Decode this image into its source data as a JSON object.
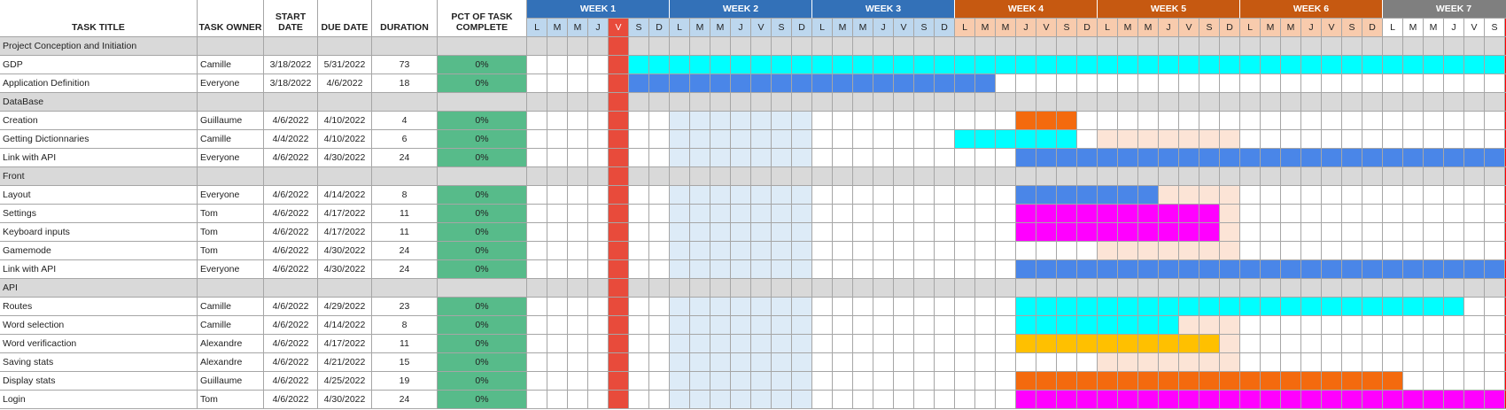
{
  "headers": {
    "task_title": "TASK TITLE",
    "task_owner": "TASK OWNER",
    "start_date": "START DATE",
    "due_date": "DUE DATE",
    "duration": "DURATION",
    "pct_complete": "PCT OF TASK COMPLETE"
  },
  "weeks": [
    {
      "label": "WEEK 1",
      "color": "#3371b8"
    },
    {
      "label": "WEEK 2",
      "color": "#3371b8"
    },
    {
      "label": "WEEK 3",
      "color": "#3371b8"
    },
    {
      "label": "WEEK 4",
      "color": "#c65911"
    },
    {
      "label": "WEEK 5",
      "color": "#c65911"
    },
    {
      "label": "WEEK 6",
      "color": "#c65911"
    },
    {
      "label": "WEEK 7",
      "color": "#7f7f7f"
    }
  ],
  "day_letters": [
    "L",
    "M",
    "M",
    "J",
    "V",
    "S",
    "D"
  ],
  "colors": {
    "red_day": "#e84b3b",
    "red_last": "#ff0000",
    "light_blue_shade": "#ddebf7",
    "light_blue_header": "#bdd7ee",
    "peach_shade": "#fce4d6",
    "peach_header": "#f8cbad",
    "cyan": "#00ffff",
    "blue": "#4a86e8",
    "orange": "#f46a0e",
    "magenta": "#ff00ff",
    "yellow": "#ffc000",
    "pct_green": "#57bb8a"
  },
  "rows": [
    {
      "type": "group",
      "title": "Project Conception and Initiation"
    },
    {
      "type": "task",
      "title": "GDP",
      "owner": "Camille",
      "start": "3/18/2022",
      "due": "5/31/2022",
      "duration": "73",
      "pct": "0%",
      "bar_start": 5,
      "bar_end": 48,
      "bar_color": "#00ffff"
    },
    {
      "type": "task",
      "title": "Application Definition",
      "owner": "Everyone",
      "start": "3/18/2022",
      "due": "4/6/2022",
      "duration": "18",
      "pct": "0%",
      "bar_start": 5,
      "bar_end": 23,
      "bar_color": "#4a86e8"
    },
    {
      "type": "group",
      "title": "DataBase"
    },
    {
      "type": "task",
      "title": "Creation",
      "owner": "Guillaume",
      "start": "4/6/2022",
      "due": "4/10/2022",
      "duration": "4",
      "pct": "0%",
      "bar_start": 24,
      "bar_end": 27,
      "bar_color": "#f46a0e"
    },
    {
      "type": "task",
      "title": "Getting Dictionnaries",
      "owner": "Camille",
      "start": "4/4/2022",
      "due": "4/10/2022",
      "duration": "6",
      "pct": "0%",
      "bar_start": 21,
      "bar_end": 27,
      "bar_color": "#00ffff"
    },
    {
      "type": "task",
      "title": "Link with API",
      "owner": "Everyone",
      "start": "4/6/2022",
      "due": "4/30/2022",
      "duration": "24",
      "pct": "0%",
      "bar_start": 24,
      "bar_end": 48,
      "bar_color": "#4a86e8"
    },
    {
      "type": "group",
      "title": "Front"
    },
    {
      "type": "task",
      "title": "Layout",
      "owner": "Everyone",
      "start": "4/6/2022",
      "due": "4/14/2022",
      "duration": "8",
      "pct": "0%",
      "bar_start": 24,
      "bar_end": 31,
      "bar_color": "#4a86e8"
    },
    {
      "type": "task",
      "title": "Settings",
      "owner": "Tom",
      "start": "4/6/2022",
      "due": "4/17/2022",
      "duration": "11",
      "pct": "0%",
      "bar_start": 24,
      "bar_end": 34,
      "bar_color": "#ff00ff"
    },
    {
      "type": "task",
      "title": "Keyboard inputs",
      "owner": "Tom",
      "start": "4/6/2022",
      "due": "4/17/2022",
      "duration": "11",
      "pct": "0%",
      "bar_start": 24,
      "bar_end": 34,
      "bar_color": "#ff00ff"
    },
    {
      "type": "task",
      "title": "Gamemode",
      "owner": "Tom",
      "start": "4/6/2022",
      "due": "4/30/2022",
      "duration": "24",
      "pct": "0%",
      "bar_start": -1,
      "bar_end": -1,
      "bar_color": ""
    },
    {
      "type": "task",
      "title": "Link with API",
      "owner": "Everyone",
      "start": "4/6/2022",
      "due": "4/30/2022",
      "duration": "24",
      "pct": "0%",
      "bar_start": 24,
      "bar_end": 48,
      "bar_color": "#4a86e8"
    },
    {
      "type": "group",
      "title": "API"
    },
    {
      "type": "task",
      "title": "Routes",
      "owner": "Camille",
      "start": "4/6/2022",
      "due": "4/29/2022",
      "duration": "23",
      "pct": "0%",
      "bar_start": 24,
      "bar_end": 46,
      "bar_color": "#00ffff"
    },
    {
      "type": "task",
      "title": "Word selection",
      "owner": "Camille",
      "start": "4/6/2022",
      "due": "4/14/2022",
      "duration": "8",
      "pct": "0%",
      "bar_start": 24,
      "bar_end": 32,
      "bar_color": "#00ffff"
    },
    {
      "type": "task",
      "title": "Word verificaction",
      "owner": "Alexandre",
      "start": "4/6/2022",
      "due": "4/17/2022",
      "duration": "11",
      "pct": "0%",
      "bar_start": 24,
      "bar_end": 34,
      "bar_color": "#ffc000"
    },
    {
      "type": "task",
      "title": "Saving stats",
      "owner": "Alexandre",
      "start": "4/6/2022",
      "due": "4/21/2022",
      "duration": "15",
      "pct": "0%",
      "bar_start": -1,
      "bar_end": -1,
      "bar_color": ""
    },
    {
      "type": "task",
      "title": "Display stats",
      "owner": "Guillaume",
      "start": "4/6/2022",
      "due": "4/25/2022",
      "duration": "19",
      "pct": "0%",
      "bar_start": 24,
      "bar_end": 43,
      "bar_color": "#f46a0e"
    },
    {
      "type": "task",
      "title": "Login",
      "owner": "Tom",
      "start": "4/6/2022",
      "due": "4/30/2022",
      "duration": "24",
      "pct": "0%",
      "bar_start": 24,
      "bar_end": 48,
      "bar_color": "#ff00ff"
    }
  ]
}
